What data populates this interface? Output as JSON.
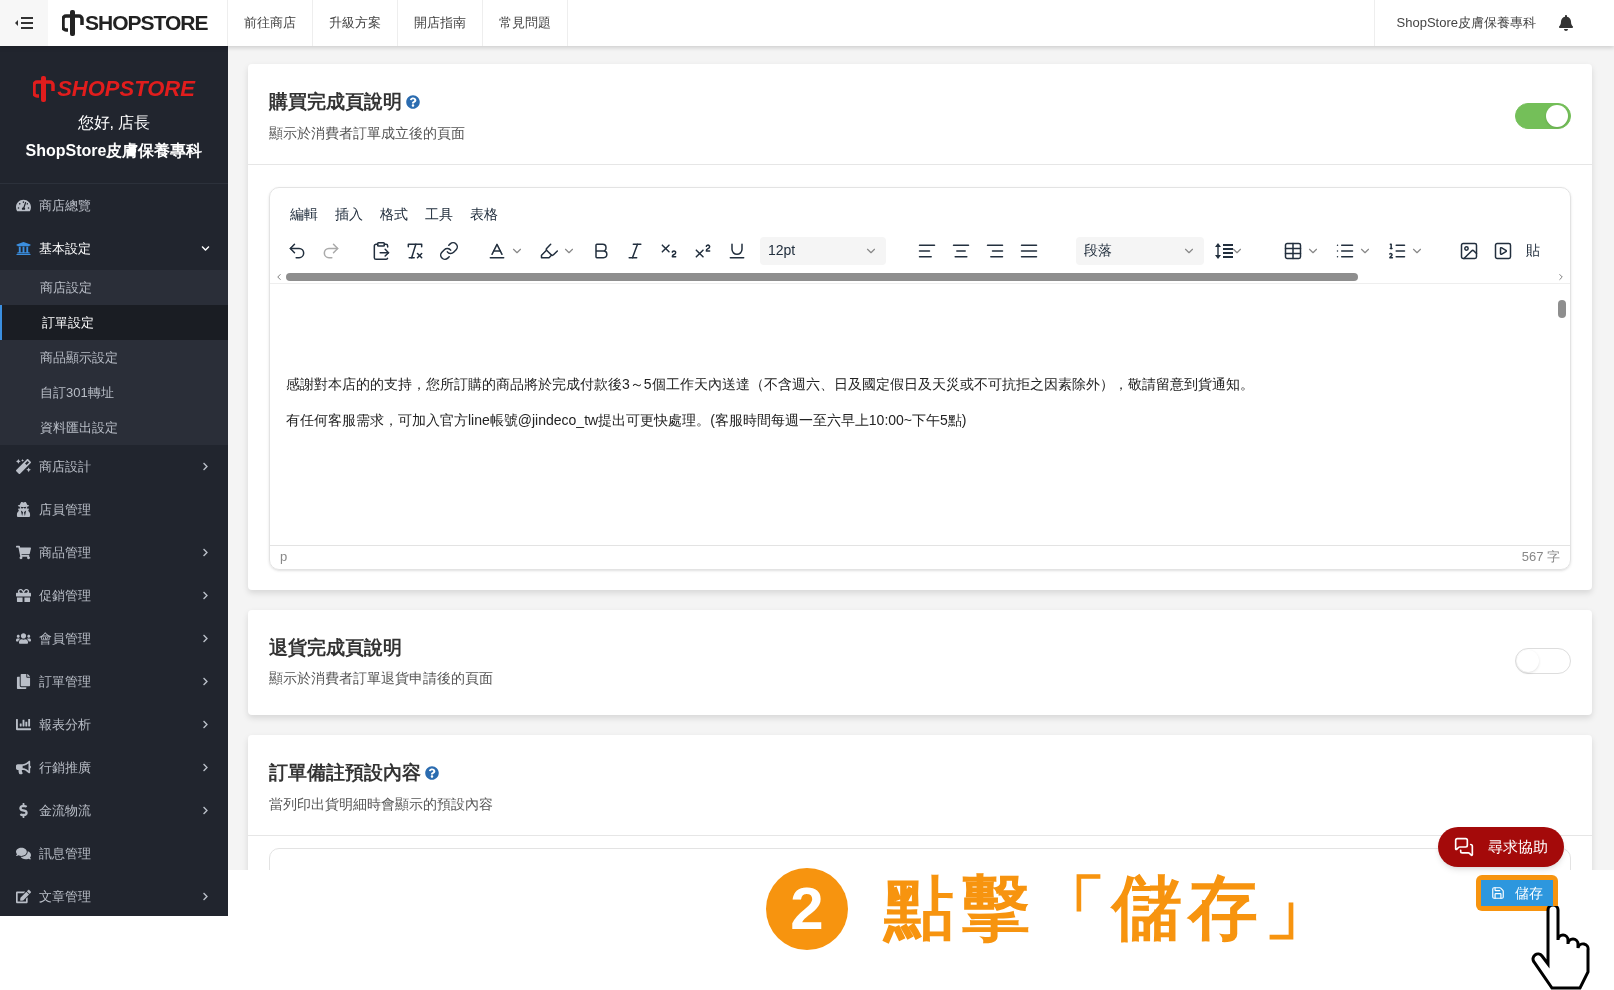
{
  "topbar": {
    "logo": "SHOPSTORE",
    "nav": [
      "前往商店",
      "升級方案",
      "開店指南",
      "常見問題"
    ],
    "store_name": "ShopStore皮膚保養專科"
  },
  "sidebar": {
    "logo": "SHOPSTORE",
    "greeting": "您好, 店長",
    "store_name": "ShopStore皮膚保養專科",
    "items": [
      {
        "label": "商店總覽",
        "expanded": false,
        "has_children": false
      },
      {
        "label": "基本設定",
        "expanded": true,
        "has_children": true,
        "children": [
          {
            "label": "商店設定",
            "selected": false
          },
          {
            "label": "訂單設定",
            "selected": true
          },
          {
            "label": "商品顯示設定",
            "selected": false
          },
          {
            "label": "自訂301轉址",
            "selected": false
          },
          {
            "label": "資料匯出設定",
            "selected": false
          }
        ]
      },
      {
        "label": "商店設計",
        "expanded": false,
        "has_children": true
      },
      {
        "label": "店員管理",
        "expanded": false,
        "has_children": false
      },
      {
        "label": "商品管理",
        "expanded": false,
        "has_children": true
      },
      {
        "label": "促銷管理",
        "expanded": false,
        "has_children": true
      },
      {
        "label": "會員管理",
        "expanded": false,
        "has_children": true
      },
      {
        "label": "訂單管理",
        "expanded": false,
        "has_children": true
      },
      {
        "label": "報表分析",
        "expanded": false,
        "has_children": true
      },
      {
        "label": "行銷推廣",
        "expanded": false,
        "has_children": true
      },
      {
        "label": "金流物流",
        "expanded": false,
        "has_children": true
      },
      {
        "label": "訊息管理",
        "expanded": false,
        "has_children": false
      },
      {
        "label": "文章管理",
        "expanded": false,
        "has_children": true
      }
    ]
  },
  "cards": [
    {
      "title": "購買完成頁說明",
      "help": true,
      "subtitle": "顯示於消費者訂單成立後的頁面",
      "toggle": {
        "on": true
      },
      "editor": {
        "menu": [
          "編輯",
          "插入",
          "格式",
          "工具",
          "表格"
        ],
        "font_size": "12pt",
        "block": "段落",
        "cut_label": "貼",
        "paragraphs": [
          "感謝對本店的的支持，您所訂購的商品將於完成付款後3～5個工作天內送達（不含週六、日及國定假日及天災或不可抗拒之因素除外），敬請留意到貨通知。",
          "有任何客服需求，可加入官方line帳號@jindeco_tw提出可更快處理。(客服時間每週一至六早上10:00~下午5點)"
        ],
        "path": "p",
        "word_count": "567 字"
      }
    },
    {
      "title": "退貨完成頁說明",
      "help": false,
      "subtitle": "顯示於消費者訂單退貨申請後的頁面",
      "toggle": {
        "on": false
      }
    },
    {
      "title": "訂單備註預設內容",
      "help": true,
      "subtitle": "當列印出貨明細時會顯示的預設內容",
      "partial_editor": true
    }
  ],
  "help_button": "尋求協助",
  "save_button": "儲存",
  "annotation": {
    "step": "2",
    "text": "點擊「儲存」"
  }
}
